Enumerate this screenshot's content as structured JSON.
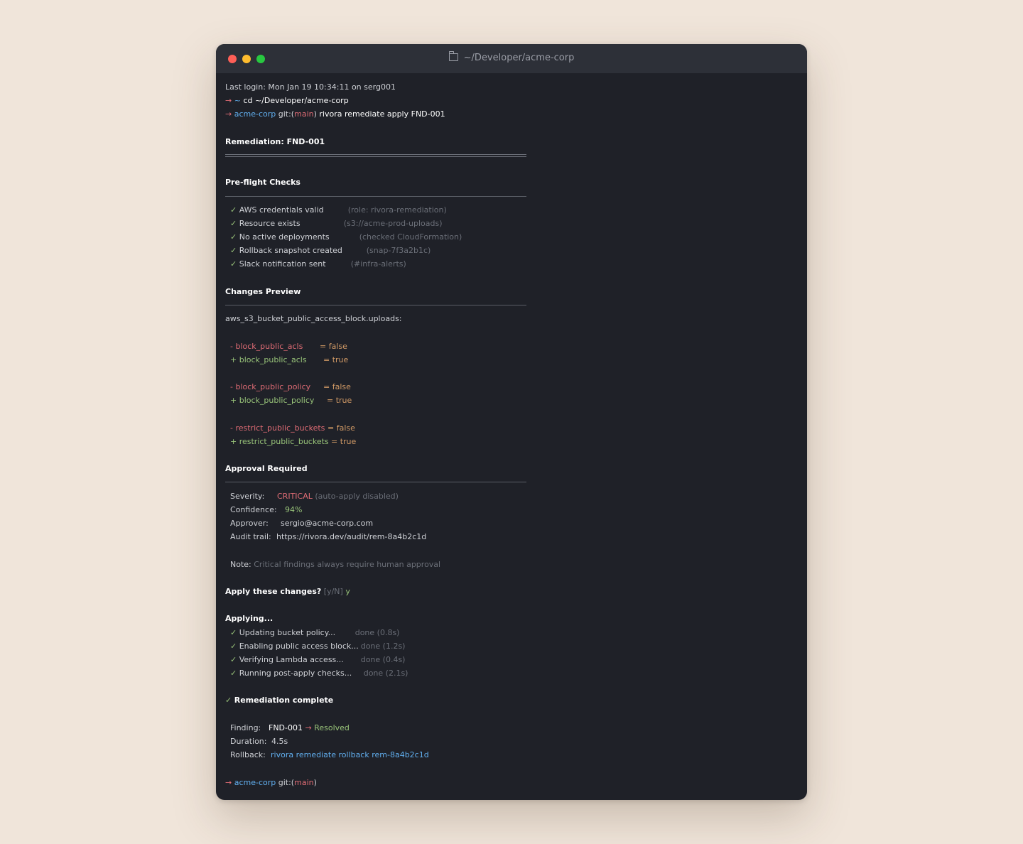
{
  "window": {
    "title": "~/Developer/acme-corp",
    "folder_icon": "folder-icon"
  },
  "terminal": {
    "last_login": "Last login: Mon Jan 19 10:34:11 on serg001",
    "prompt_arrow": "→",
    "home_tilde": "~",
    "cmd1": "cd ~/Developer/acme-corp",
    "dir": "acme-corp",
    "git_prefix": "git:(",
    "branch": "main",
    "git_suffix": ")",
    "cmd2": "rivora remediate apply FND-001",
    "heading": "Remediation: FND-001",
    "preflight": {
      "title": "Pre-flight Checks",
      "check_mark": "✓",
      "items": [
        {
          "label": "AWS credentials valid",
          "detail": "(role: rivora-remediation)"
        },
        {
          "label": "Resource exists",
          "detail": "(s3://acme-prod-uploads)"
        },
        {
          "label": "No active deployments",
          "detail": "(checked CloudFormation)"
        },
        {
          "label": "Rollback snapshot created",
          "detail": "(snap-7f3a2b1c)"
        },
        {
          "label": "Slack notification sent",
          "detail": "(#infra-alerts)"
        }
      ]
    },
    "changes": {
      "title": "Changes Preview",
      "resource": "aws_s3_bucket_public_access_block.uploads:",
      "diff": [
        {
          "minus": "- block_public_acls",
          "minus_val": "= false",
          "plus": "+ block_public_acls",
          "plus_val": "= true"
        },
        {
          "minus": "- block_public_policy",
          "minus_val": "= false",
          "plus": "+ block_public_policy",
          "plus_val": "= true"
        },
        {
          "minus": "- restrict_public_buckets",
          "minus_val": "= false",
          "plus": "+ restrict_public_buckets",
          "plus_val": "= true"
        }
      ]
    },
    "approval": {
      "title": "Approval Required",
      "severity_label": "Severity:",
      "severity_value": "CRITICAL",
      "severity_note": "(auto-apply disabled)",
      "confidence_label": "Confidence:",
      "confidence_value": "94%",
      "approver_label": "Approver:",
      "approver_value": "sergio@acme-corp.com",
      "audit_label": "Audit trail:",
      "audit_value": "https://rivora.dev/audit/rem-8a4b2c1d",
      "note_label": "Note:",
      "note_text": "Critical findings always require human approval"
    },
    "confirm": {
      "question": "Apply these changes?",
      "options": "[y/N]",
      "answer": "y"
    },
    "applying": {
      "title": "Applying...",
      "steps": [
        {
          "label": "Updating bucket policy...",
          "status": "done (0.8s)"
        },
        {
          "label": "Enabling public access block...",
          "status": "done (1.2s)"
        },
        {
          "label": "Verifying Lambda access...",
          "status": "done (0.4s)"
        },
        {
          "label": "Running post-apply checks...",
          "status": "done (2.1s)"
        }
      ]
    },
    "complete": {
      "title": "Remediation complete",
      "finding_label": "Finding:",
      "finding_id": "FND-001",
      "finding_arrow": "→",
      "finding_status": "Resolved",
      "duration_label": "Duration:",
      "duration_value": "4.5s",
      "rollback_label": "Rollback:",
      "rollback_cmd": "rivora remediate rollback rem-8a4b2c1d"
    }
  },
  "colors": {
    "page_bg": "#f0e5da",
    "terminal_bg": "#1f2128",
    "titlebar_bg": "#2d3038",
    "red": "#e06c75",
    "green": "#98c379",
    "blue": "#61afef",
    "orange": "#d19a66",
    "dim": "#6b6f78"
  }
}
